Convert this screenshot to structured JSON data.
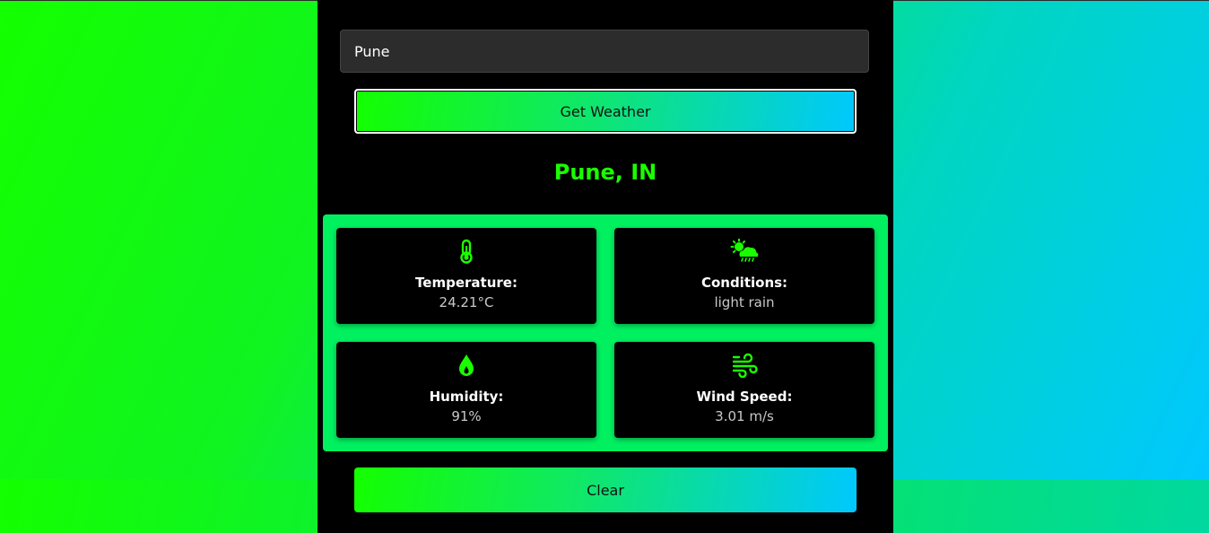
{
  "search": {
    "value": "Pune"
  },
  "buttons": {
    "get_weather": "Get Weather",
    "clear": "Clear"
  },
  "location": "Pune, IN",
  "cards": [
    {
      "label": "Temperature:",
      "value": "24.21°C",
      "icon": "thermometer-icon"
    },
    {
      "label": "Conditions:",
      "value": "light rain",
      "icon": "sun-cloud-rain-icon"
    },
    {
      "label": "Humidity:",
      "value": "91%",
      "icon": "droplet-icon"
    },
    {
      "label": "Wind Speed:",
      "value": "3.01 m/s",
      "icon": "wind-icon"
    }
  ],
  "colors": {
    "accent": "#1aff00",
    "panel": "#000000",
    "grid": "#00f060"
  }
}
